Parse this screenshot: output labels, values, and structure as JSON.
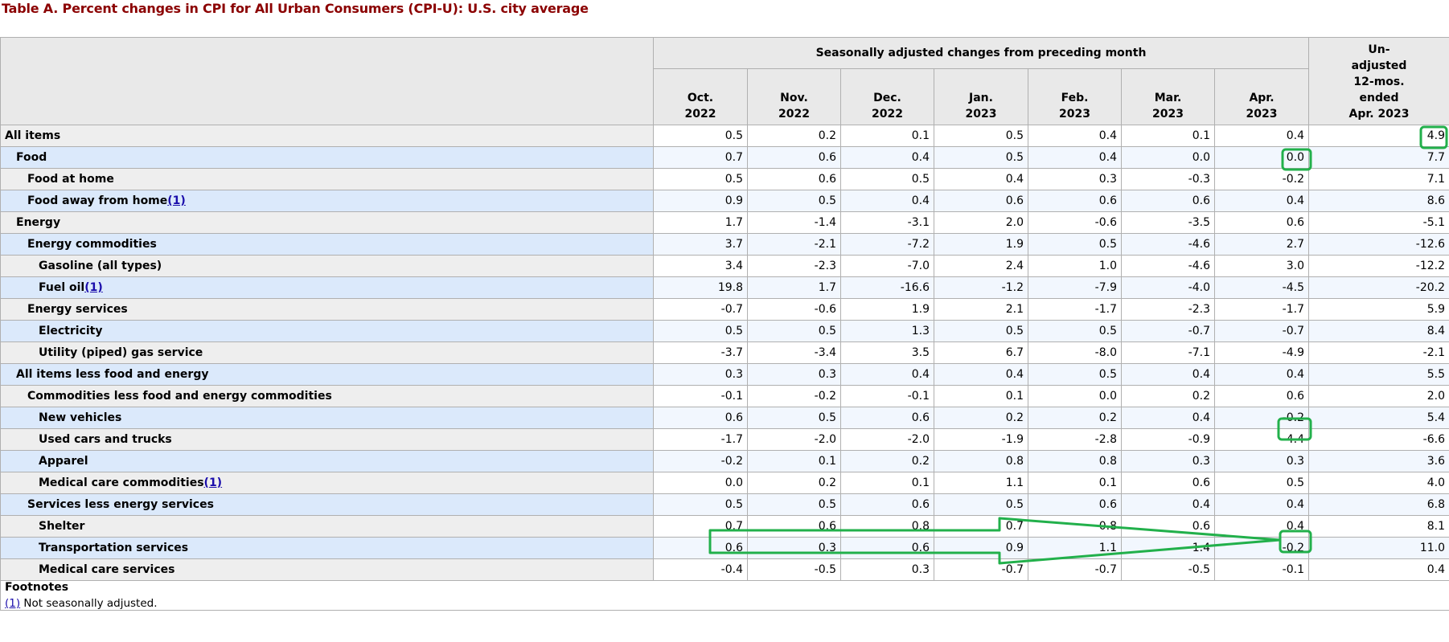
{
  "caption": "Table A. Percent changes in CPI for All Urban Consumers (CPI-U): U.S. city average",
  "header": {
    "group_label": "Seasonally adjusted changes from preceding month",
    "months": [
      {
        "m": "Oct.",
        "y": "2022"
      },
      {
        "m": "Nov.",
        "y": "2022"
      },
      {
        "m": "Dec.",
        "y": "2022"
      },
      {
        "m": "Jan.",
        "y": "2023"
      },
      {
        "m": "Feb.",
        "y": "2023"
      },
      {
        "m": "Mar.",
        "y": "2023"
      },
      {
        "m": "Apr.",
        "y": "2023"
      }
    ],
    "unadjusted": [
      "Un-",
      "adjusted",
      "12-mos.",
      "ended",
      "Apr. 2023"
    ]
  },
  "rows": [
    {
      "label": "All items",
      "indent": 0,
      "fn": "",
      "values": [
        "0.5",
        "0.2",
        "0.1",
        "0.5",
        "0.4",
        "0.1",
        "0.4",
        "4.9"
      ]
    },
    {
      "label": "Food",
      "indent": 1,
      "fn": "",
      "values": [
        "0.7",
        "0.6",
        "0.4",
        "0.5",
        "0.4",
        "0.0",
        "0.0",
        "7.7"
      ]
    },
    {
      "label": "Food at home",
      "indent": 2,
      "fn": "",
      "values": [
        "0.5",
        "0.6",
        "0.5",
        "0.4",
        "0.3",
        "-0.3",
        "-0.2",
        "7.1"
      ]
    },
    {
      "label": "Food away from home",
      "indent": 2,
      "fn": "(1)",
      "values": [
        "0.9",
        "0.5",
        "0.4",
        "0.6",
        "0.6",
        "0.6",
        "0.4",
        "8.6"
      ]
    },
    {
      "label": "Energy",
      "indent": 1,
      "fn": "",
      "values": [
        "1.7",
        "-1.4",
        "-3.1",
        "2.0",
        "-0.6",
        "-3.5",
        "0.6",
        "-5.1"
      ]
    },
    {
      "label": "Energy commodities",
      "indent": 2,
      "fn": "",
      "values": [
        "3.7",
        "-2.1",
        "-7.2",
        "1.9",
        "0.5",
        "-4.6",
        "2.7",
        "-12.6"
      ]
    },
    {
      "label": "Gasoline (all types)",
      "indent": 3,
      "fn": "",
      "values": [
        "3.4",
        "-2.3",
        "-7.0",
        "2.4",
        "1.0",
        "-4.6",
        "3.0",
        "-12.2"
      ]
    },
    {
      "label": "Fuel oil",
      "indent": 3,
      "fn": "(1)",
      "values": [
        "19.8",
        "1.7",
        "-16.6",
        "-1.2",
        "-7.9",
        "-4.0",
        "-4.5",
        "-20.2"
      ]
    },
    {
      "label": "Energy services",
      "indent": 2,
      "fn": "",
      "values": [
        "-0.7",
        "-0.6",
        "1.9",
        "2.1",
        "-1.7",
        "-2.3",
        "-1.7",
        "5.9"
      ]
    },
    {
      "label": "Electricity",
      "indent": 3,
      "fn": "",
      "values": [
        "0.5",
        "0.5",
        "1.3",
        "0.5",
        "0.5",
        "-0.7",
        "-0.7",
        "8.4"
      ]
    },
    {
      "label": "Utility (piped) gas service",
      "indent": 3,
      "fn": "",
      "values": [
        "-3.7",
        "-3.4",
        "3.5",
        "6.7",
        "-8.0",
        "-7.1",
        "-4.9",
        "-2.1"
      ]
    },
    {
      "label": "All items less food and energy",
      "indent": 1,
      "fn": "",
      "values": [
        "0.3",
        "0.3",
        "0.4",
        "0.4",
        "0.5",
        "0.4",
        "0.4",
        "5.5"
      ]
    },
    {
      "label": "Commodities less food and energy commodities",
      "indent": 2,
      "fn": "",
      "values": [
        "-0.1",
        "-0.2",
        "-0.1",
        "0.1",
        "0.0",
        "0.2",
        "0.6",
        "2.0"
      ]
    },
    {
      "label": "New vehicles",
      "indent": 3,
      "fn": "",
      "values": [
        "0.6",
        "0.5",
        "0.6",
        "0.2",
        "0.2",
        "0.4",
        "-0.2",
        "5.4"
      ]
    },
    {
      "label": "Used cars and trucks",
      "indent": 3,
      "fn": "",
      "values": [
        "-1.7",
        "-2.0",
        "-2.0",
        "-1.9",
        "-2.8",
        "-0.9",
        "4.4",
        "-6.6"
      ]
    },
    {
      "label": "Apparel",
      "indent": 3,
      "fn": "",
      "values": [
        "-0.2",
        "0.1",
        "0.2",
        "0.8",
        "0.8",
        "0.3",
        "0.3",
        "3.6"
      ]
    },
    {
      "label": "Medical care commodities",
      "indent": 3,
      "fn": "(1)",
      "values": [
        "0.0",
        "0.2",
        "0.1",
        "1.1",
        "0.1",
        "0.6",
        "0.5",
        "4.0"
      ]
    },
    {
      "label": "Services less energy services",
      "indent": 2,
      "fn": "",
      "values": [
        "0.5",
        "0.5",
        "0.6",
        "0.5",
        "0.6",
        "0.4",
        "0.4",
        "6.8"
      ]
    },
    {
      "label": "Shelter",
      "indent": 3,
      "fn": "",
      "values": [
        "0.7",
        "0.6",
        "0.8",
        "0.7",
        "0.8",
        "0.6",
        "0.4",
        "8.1"
      ]
    },
    {
      "label": "Transportation services",
      "indent": 3,
      "fn": "",
      "values": [
        "0.6",
        "0.3",
        "0.6",
        "0.9",
        "1.1",
        "1.4",
        "-0.2",
        "11.0"
      ]
    },
    {
      "label": "Medical care services",
      "indent": 3,
      "fn": "",
      "values": [
        "-0.4",
        "-0.5",
        "0.3",
        "-0.7",
        "-0.7",
        "-0.5",
        "-0.1",
        "0.4"
      ]
    }
  ],
  "footnotes": {
    "title": "Footnotes",
    "items": [
      {
        "ref": "(1)",
        "text": " Not seasonally adjusted."
      }
    ]
  },
  "annotations": {
    "color": "#22b04b",
    "boxed_cells": [
      "All items / Un-adjusted 12-mos.",
      "Food / Apr. 2023",
      "New vehicles / Apr. 2023",
      "Shelter / Apr. 2023"
    ],
    "arrow": "Shelter Oct. 2022 to Mar. 2023 pointing to Apr. 2023"
  }
}
